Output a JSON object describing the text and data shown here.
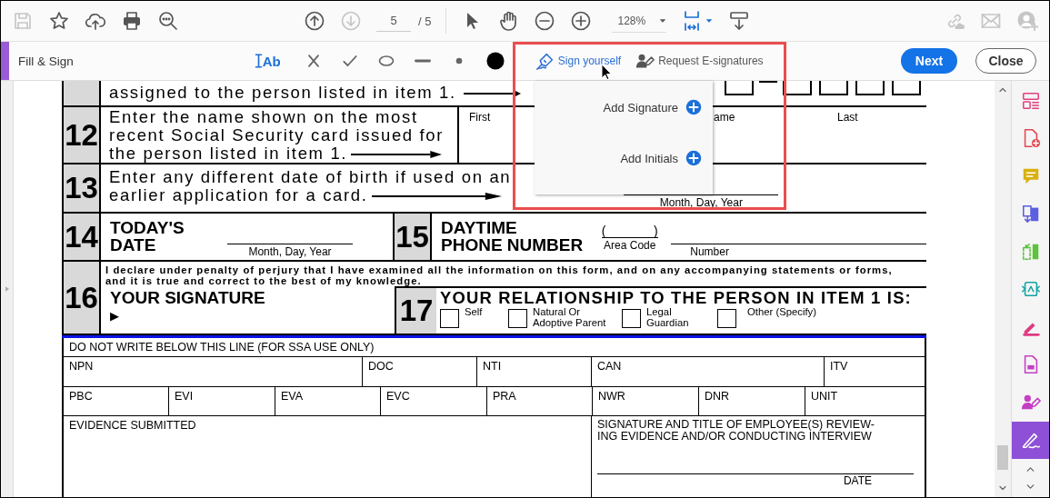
{
  "toolbar": {
    "left": [
      {
        "kind": "save",
        "disabled": true
      },
      {
        "kind": "star",
        "disabled": false
      },
      {
        "kind": "upload",
        "disabled": false
      },
      {
        "kind": "print",
        "disabled": false
      },
      {
        "kind": "zoom-search",
        "disabled": false
      }
    ],
    "nav": [
      {
        "kind": "up",
        "disabled": false
      },
      {
        "kind": "down",
        "disabled": true
      }
    ],
    "page": "5",
    "page_total": "/ 5",
    "tools": [
      {
        "kind": "pointer"
      },
      {
        "kind": "hand"
      },
      {
        "kind": "zoom-out"
      },
      {
        "kind": "zoom-in"
      }
    ],
    "zoom": "128%",
    "view": [
      {
        "kind": "fit",
        "menu": true
      },
      {
        "kind": "scroll",
        "menu": false
      }
    ],
    "right": [
      {
        "kind": "link",
        "disabled": true
      },
      {
        "kind": "mail",
        "disabled": true
      },
      {
        "kind": "user",
        "disabled": true
      }
    ]
  },
  "fill_sign_bar": {
    "title": "Fill & Sign",
    "tools": [
      {
        "kind": "text",
        "label": "Ab"
      },
      {
        "kind": "cross"
      },
      {
        "kind": "check"
      },
      {
        "kind": "ellipse"
      },
      {
        "kind": "line"
      },
      {
        "kind": "dot"
      },
      {
        "kind": "big-dot"
      }
    ],
    "sign_actions": [
      {
        "kind": "sign",
        "label": "Sign yourself",
        "selected": true
      },
      {
        "kind": "request",
        "label": "Request E-signatures",
        "selected": false
      }
    ],
    "buttons": [
      {
        "kind": "primary",
        "label": "Next"
      },
      {
        "kind": "secondary",
        "label": "Close"
      }
    ]
  },
  "sign_menu": {
    "items": [
      {
        "label": "Add Signature"
      },
      {
        "label": "Add Initials"
      }
    ]
  },
  "form": {
    "item_11": {
      "text": "assigned to the person listed in item 1."
    },
    "item_12": {
      "number": "12",
      "lines": [
        "Enter the name shown on the most",
        "recent Social Security card issued for",
        "the person listed in item 1."
      ],
      "fields": [
        "First",
        "ame",
        "Last"
      ]
    },
    "item_13": {
      "number": "13",
      "lines": [
        "Enter any different date of birth if used on an",
        "earlier application for a card."
      ],
      "hint": "Month, Day, Year"
    },
    "item_14": {
      "number": "14",
      "title_lines": [
        "TODAY'S",
        "DATE"
      ],
      "hint": "Month, Day, Year"
    },
    "item_15": {
      "number": "15",
      "title_lines": [
        "DAYTIME",
        "PHONE NUMBER"
      ],
      "paren_open": "(",
      "paren_close": ")",
      "area_label": "Area Code",
      "number_label": "Number"
    },
    "item_16": {
      "number": "16",
      "declaration_lines": [
        "I declare under penalty of perjury that I have examined all the information on this form, and on any accompanying statements or forms,",
        "and it is true and correct to the best of my knowledge."
      ],
      "title": "YOUR SIGNATURE",
      "marker": "▶"
    },
    "item_17": {
      "number": "17",
      "title": "YOUR RELATIONSHIP TO THE PERSON IN ITEM 1 IS:",
      "options": [
        {
          "label_lines": [
            "Self"
          ],
          "checked": false
        },
        {
          "label_lines": [
            "Natural Or",
            "Adoptive Parent"
          ],
          "checked": false
        },
        {
          "label_lines": [
            "Legal",
            "Guardian"
          ],
          "checked": false
        },
        {
          "label_lines": [
            "Other (Specify)"
          ],
          "checked": false
        }
      ]
    }
  },
  "ssa": {
    "heading": "DO NOT WRITE BELOW THIS LINE (FOR SSA USE ONLY)",
    "upper_fields": [
      "NPN",
      "DOC",
      "NTI",
      "CAN",
      "ITV"
    ],
    "lower_fields": [
      "PBC",
      "EVI",
      "EVA",
      "EVC",
      "PRA",
      "NWR",
      "DNR",
      "UNIT"
    ],
    "evidence": "EVIDENCE SUBMITTED",
    "signature_lines": [
      "SIGNATURE AND TITLE OF EMPLOYEE(S) REVIEW-",
      "ING EVIDENCE AND/OR CONDUCTING INTERVIEW"
    ],
    "date": "DATE"
  },
  "side_panel": {
    "tools": [
      {
        "kind": "organize",
        "color": "#e2407f",
        "selected": false
      },
      {
        "kind": "create-pdf",
        "color": "#e34850",
        "selected": false
      },
      {
        "kind": "comment",
        "color": "#d9b00f",
        "selected": false
      },
      {
        "kind": "export",
        "color": "#5b5fe0",
        "selected": false
      },
      {
        "kind": "pages",
        "color": "#5cc33c",
        "selected": false
      },
      {
        "kind": "compress",
        "color": "#14a3a3",
        "selected": false
      },
      {
        "kind": "highlighter",
        "color": "#e03a80",
        "selected": false
      },
      {
        "kind": "protect",
        "color": "#c43fc4",
        "selected": false
      },
      {
        "kind": "request-sign",
        "color": "#c43fc4",
        "selected": false
      },
      {
        "kind": "sign",
        "color": "#ffffff",
        "selected": true
      }
    ]
  }
}
